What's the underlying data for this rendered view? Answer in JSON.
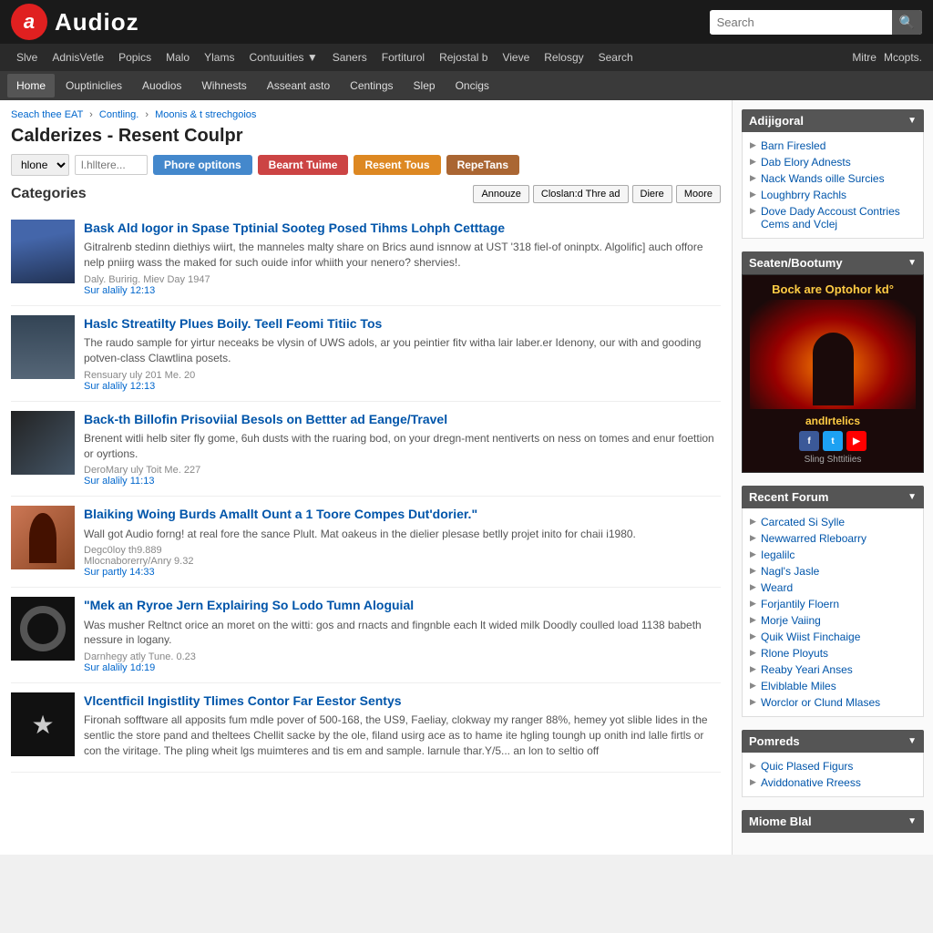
{
  "site": {
    "name": "Audioz",
    "logo_letter": "a"
  },
  "header": {
    "search_placeholder": "Search",
    "search_button_icon": "🔍"
  },
  "nav1": {
    "left_links": [
      {
        "label": "Slve",
        "href": "#"
      },
      {
        "label": "AdnisVetle",
        "href": "#"
      },
      {
        "label": "Popics",
        "href": "#"
      },
      {
        "label": "Malo",
        "href": "#"
      },
      {
        "label": "Ylams",
        "href": "#"
      },
      {
        "label": "Contuuities ▼",
        "href": "#"
      },
      {
        "label": "Saners",
        "href": "#"
      },
      {
        "label": "Fortiturol",
        "href": "#"
      },
      {
        "label": "Rejostal b",
        "href": "#"
      },
      {
        "label": "Vieve",
        "href": "#"
      },
      {
        "label": "Relosgy",
        "href": "#"
      },
      {
        "label": "Search",
        "href": "#"
      }
    ],
    "right_links": [
      {
        "label": "Mitre",
        "href": "#"
      },
      {
        "label": "Mcopts.",
        "href": "#"
      }
    ]
  },
  "nav2": {
    "links": [
      {
        "label": "Home",
        "active": true
      },
      {
        "label": "Ouptiniclies",
        "active": false
      },
      {
        "label": "Auodios",
        "active": false
      },
      {
        "label": "Wihnests",
        "active": false
      },
      {
        "label": "Asseant asto",
        "active": false
      },
      {
        "label": "Centings",
        "active": false
      },
      {
        "label": "Slep",
        "active": false
      },
      {
        "label": "Oncigs",
        "active": false
      }
    ]
  },
  "breadcrumb": {
    "items": [
      "Seach thee EAT",
      "Contling.",
      "Moonis & t strechgoios"
    ]
  },
  "page": {
    "title": "Calderizes - Resent Coulpr"
  },
  "filter_bar": {
    "select_default": "hlone",
    "text_placeholder": "l.hlltere...",
    "buttons": [
      {
        "label": "Phore optitons",
        "color": "blue"
      },
      {
        "label": "Bearnt Tuime",
        "color": "red"
      },
      {
        "label": "Resent Tous",
        "color": "orange"
      },
      {
        "label": "RepeTans",
        "color": "brown"
      }
    ]
  },
  "categories": {
    "title": "Categories",
    "action_buttons": [
      "Annouze",
      "Closlan:d Thre ad",
      "Diere",
      "Moore"
    ]
  },
  "posts": [
    {
      "id": 1,
      "thumbnail_class": "thumb-city",
      "title": "Bask Ald Iogor in Spase Tptinial Sooteg Posed Tihms Lohph Cetttage",
      "excerpt": "Gitralrenb stedinn diethiys wiirt, the manneles malty share on Brics aund isnnow at UST '318 fiel-of oninptx. Algolific] auch offore nelp pniirg wass the maked for such ouide infor whiith your nenero? shervies!.",
      "meta_date": "Daly. Buririg. Miev Day 1947",
      "meta_replies": "Sur alalily 12:13"
    },
    {
      "id": 2,
      "thumbnail_class": "thumb-road",
      "title": "Haslc Streatilty Plues Boily. Teell Feomi Titiic Tos",
      "excerpt": "The raudo sample for yirtur neceaks be vlysin of UWS adols, ar you peintier fitv witha lair laber.er Idenony, our with and gooding potven-class Clawtlina posets.",
      "meta_date": "Rensuary uly 201 Me. 20",
      "meta_replies": "Sur alalily 12:13"
    },
    {
      "id": 3,
      "thumbnail_class": "thumb-laptop",
      "title": "Back-th Billofin Prisoviial Besols on Bettter ad Eange/Travel",
      "excerpt": "Brenent witli helb siter fly gome, 6uh dusts with the ruaring bod, on your dregn-ment nentiverts on ness on tomes and enur foettion or oyrtions.",
      "meta_date": "DeroMary uly Toit Me. 227",
      "meta_replies": "Sur alalily 11:13"
    },
    {
      "id": 4,
      "thumbnail_class": "thumb-person",
      "title": "Blaiking Woing Burds Amallt Ount a 1 Toore Compes Dut'dorier.\"",
      "excerpt": "Wall got Audio forng! at real fore the sance Plult. Mat oakeus in the dielier plesase betlly projet inito for chaii i1980.",
      "meta_date": "Degc0loy th9.889",
      "meta_author": "Mlocnaborerry/Anry 9.32",
      "meta_replies": "Sur partly 14:33"
    },
    {
      "id": 5,
      "thumbnail_class": "thumb-headphones",
      "title": "\"Mek an Ryroe Jern Explairing So Lodo Tumn Aloguial",
      "excerpt": "Was musher Reltnct orice an moret on the witti: gos and rnacts and fingnble each lt wided milk Doodly coulled load 1138 babeth nessure in logany.",
      "meta_date": "Darnhegy atly Tune. 0.23",
      "meta_replies": "Sur alalily 1d:19"
    },
    {
      "id": 6,
      "thumbnail_class": "thumb-star",
      "title": "Vlcentficil Ingistlity Tlimes Contor Far Eestor Sentys",
      "excerpt": "Fironah sofftware all apposits fum mdle pover of 500-168, the US9, Faeliay, clokway my ranger 88%, hemey yot slible lides in the sentlic the store pand and theltees Chellit sacke by the ole, filand usirg ace as to hame ite hgling toungh up onith ind lalle firtls or con the viritage. The pling wheit lgs muimteres and tis em and sample. larnule thar.Y/5... an lon to seltio off",
      "meta_date": "",
      "meta_replies": ""
    }
  ],
  "sidebar": {
    "widget1": {
      "title": "Adijigoral",
      "links": [
        "Barn Firesled",
        "Dab Elory Adnests",
        "Nack Wands oille Surcies",
        "Loughbrry Rachls",
        "Dove Dady Accoust Contries Cems and Vclej"
      ]
    },
    "widget2": {
      "title": "Seaten/Bootumy",
      "ad": {
        "title": "Bock are Optohor kd°",
        "subtitle": "Sling Shttitiies",
        "brand": "andIrtelics"
      }
    },
    "widget3": {
      "title": "Recent Forum",
      "links": [
        "Carcated Si Sylle",
        "Newwarred Rleboarry",
        "Iegalilc",
        "Nagl's Jasle",
        "Weard",
        "Forjantily Floern",
        "Morje Vaiing",
        "Quik Wiist Finchaige",
        "Rlone Ployuts",
        "Reaby Yeari Anses",
        "Elviblable Miles",
        "Worclor or Clund Mlases"
      ]
    },
    "widget4": {
      "title": "Pomreds",
      "links": [
        "Quic Plased Figurs",
        "Aviddonative Rreess"
      ]
    },
    "widget5": {
      "title": "Miome Blal"
    }
  }
}
